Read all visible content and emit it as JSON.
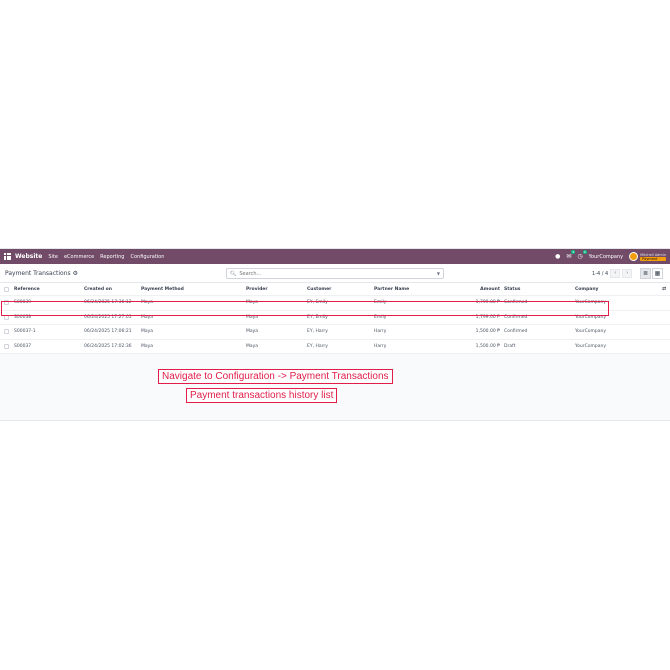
{
  "navbar": {
    "brand": "Website",
    "menu": [
      "Site",
      "eCommerce",
      "Reporting",
      "Configuration"
    ],
    "chat_badge": "5",
    "activity_badge": "4",
    "company": "YourCompany",
    "user_name": "Mitchell Admin",
    "database": "Payment"
  },
  "control": {
    "title": "Payment Transactions",
    "search_placeholder": "Search...",
    "pager": "1-4 / 4"
  },
  "table": {
    "columns": {
      "reference": "Reference",
      "created": "Created on",
      "method": "Payment Method",
      "provider": "Provider",
      "customer": "Customer",
      "partner": "Partner Name",
      "amount": "Amount",
      "status": "Status",
      "company": "Company"
    },
    "rows": [
      {
        "reference": "S00039",
        "created": "06/24/2025 17:36:12",
        "method": "Maya",
        "provider": "Maya",
        "customer": "EY, Emily",
        "partner": "Emily",
        "amount": "1,799.00 ₱",
        "status": "Confirmed",
        "company": "YourCompany"
      },
      {
        "reference": "S00038",
        "created": "06/24/2025 17:27:05",
        "method": "Maya",
        "provider": "Maya",
        "customer": "EY, Emily",
        "partner": "Emily",
        "amount": "1,799.00 ₱",
        "status": "Confirmed",
        "company": "YourCompany"
      },
      {
        "reference": "S00037-1",
        "created": "06/24/2025 17:06:21",
        "method": "Maya",
        "provider": "Maya",
        "customer": "EY, Harry",
        "partner": "Harry",
        "amount": "1,500.00 ₱",
        "status": "Confirmed",
        "company": "YourCompany"
      },
      {
        "reference": "S00037",
        "created": "06/24/2025 17:02:36",
        "method": "Maya",
        "provider": "Maya",
        "customer": "EY, Harry",
        "partner": "Harry",
        "amount": "1,500.00 ₱",
        "status": "Draft",
        "company": "YourCompany"
      }
    ]
  },
  "annotations": {
    "nav_hint": "Navigate to Configuration -> Payment Transactions",
    "list_hint": "Payment transactions history list"
  },
  "colors": {
    "navbar": "#714b67",
    "highlight": "#e11d48"
  }
}
